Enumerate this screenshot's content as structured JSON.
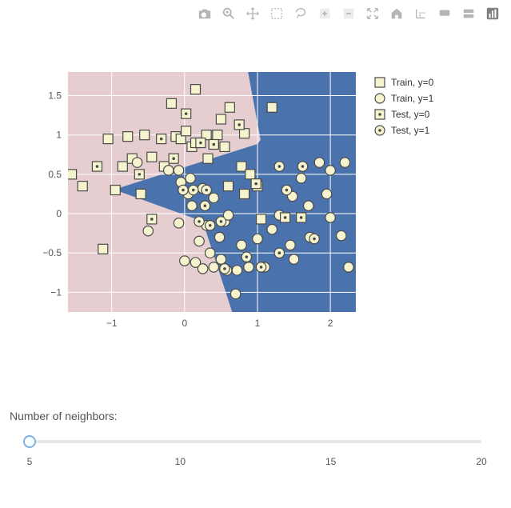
{
  "toolbar": {
    "icons": [
      "camera-icon",
      "zoom-icon",
      "pan-icon",
      "box-select-icon",
      "lasso-select-icon",
      "zoom-in-icon",
      "zoom-out-icon",
      "autoscale-icon",
      "reset-axes-icon",
      "spike-lines-icon",
      "closest-hover-icon",
      "compare-hover-icon",
      "plotly-logo-icon"
    ]
  },
  "legend": {
    "items": [
      {
        "label": "Train, y=0"
      },
      {
        "label": "Train, y=1"
      },
      {
        "label": "Test, y=0"
      },
      {
        "label": "Test, y=1"
      }
    ]
  },
  "axes": {
    "xticks": [
      "−1",
      "0",
      "1",
      "2"
    ],
    "yticks": [
      "−1",
      "−0.5",
      "0",
      "0.5",
      "1",
      "1.5"
    ]
  },
  "slider": {
    "label": "Number of neighbors:",
    "min": 5,
    "max": 20,
    "value": 5,
    "ticks": [
      "5",
      "10",
      "15",
      "20"
    ]
  },
  "chart_data": {
    "type": "scatter",
    "title": "",
    "xlabel": "",
    "ylabel": "",
    "xlim": [
      -1.6,
      2.35
    ],
    "ylim": [
      -1.25,
      1.8
    ],
    "background": "decision-boundary-contour (red=y0, blue=y1)",
    "series": [
      {
        "name": "Train, y=0",
        "marker": "square",
        "points": [
          [
            -1.55,
            0.5
          ],
          [
            -1.4,
            0.35
          ],
          [
            -1.12,
            -0.45
          ],
          [
            -1.05,
            0.95
          ],
          [
            -0.95,
            0.3
          ],
          [
            -0.85,
            0.6
          ],
          [
            -0.78,
            0.98
          ],
          [
            -0.72,
            0.7
          ],
          [
            -0.6,
            0.25
          ],
          [
            -0.55,
            1.0
          ],
          [
            -0.45,
            0.72
          ],
          [
            -0.28,
            0.6
          ],
          [
            -0.18,
            1.4
          ],
          [
            -0.12,
            0.98
          ],
          [
            -0.05,
            0.95
          ],
          [
            0.02,
            1.05
          ],
          [
            0.1,
            0.85
          ],
          [
            0.15,
            0.9
          ],
          [
            0.15,
            1.58
          ],
          [
            0.3,
            1.0
          ],
          [
            0.32,
            0.7
          ],
          [
            0.4,
            0.88
          ],
          [
            0.45,
            1.0
          ],
          [
            0.5,
            1.2
          ],
          [
            0.55,
            0.85
          ],
          [
            0.6,
            0.35
          ],
          [
            0.62,
            1.35
          ],
          [
            0.78,
            0.6
          ],
          [
            0.82,
            0.25
          ],
          [
            0.82,
            1.02
          ],
          [
            0.9,
            0.5
          ],
          [
            1.0,
            0.35
          ],
          [
            1.05,
            -0.07
          ],
          [
            1.2,
            1.35
          ]
        ]
      },
      {
        "name": "Train, y=1",
        "marker": "circle",
        "points": [
          [
            -0.65,
            0.65
          ],
          [
            -0.5,
            -0.22
          ],
          [
            -0.22,
            0.55
          ],
          [
            -0.08,
            0.55
          ],
          [
            -0.08,
            -0.12
          ],
          [
            -0.05,
            0.4
          ],
          [
            0.0,
            -0.6
          ],
          [
            0.05,
            0.25
          ],
          [
            0.08,
            0.45
          ],
          [
            0.1,
            0.1
          ],
          [
            0.15,
            -0.62
          ],
          [
            0.2,
            -0.35
          ],
          [
            0.25,
            0.32
          ],
          [
            0.25,
            -0.7
          ],
          [
            0.3,
            -0.15
          ],
          [
            0.35,
            -0.5
          ],
          [
            0.4,
            0.2
          ],
          [
            0.4,
            -0.68
          ],
          [
            0.48,
            -0.3
          ],
          [
            0.5,
            -0.58
          ],
          [
            0.55,
            -0.1
          ],
          [
            0.58,
            -0.72
          ],
          [
            0.6,
            -0.02
          ],
          [
            0.7,
            -1.02
          ],
          [
            0.72,
            -0.72
          ],
          [
            0.78,
            -0.4
          ],
          [
            0.88,
            -0.68
          ],
          [
            1.0,
            -0.32
          ],
          [
            1.1,
            -0.68
          ],
          [
            1.2,
            -0.2
          ],
          [
            1.3,
            -0.02
          ],
          [
            1.45,
            -0.4
          ],
          [
            1.48,
            0.22
          ],
          [
            1.5,
            -0.58
          ],
          [
            1.6,
            0.45
          ],
          [
            1.7,
            0.1
          ],
          [
            1.72,
            -0.3
          ],
          [
            1.85,
            0.65
          ],
          [
            1.95,
            0.25
          ],
          [
            2.0,
            -0.05
          ],
          [
            2.0,
            0.55
          ],
          [
            2.15,
            -0.28
          ],
          [
            2.2,
            0.65
          ],
          [
            2.25,
            -0.68
          ]
        ]
      },
      {
        "name": "Test, y=0",
        "marker": "square-dot",
        "points": [
          [
            -1.2,
            0.6
          ],
          [
            -0.62,
            0.5
          ],
          [
            -0.45,
            -0.07
          ],
          [
            -0.32,
            0.95
          ],
          [
            -0.15,
            0.7
          ],
          [
            0.02,
            1.27
          ],
          [
            0.22,
            0.9
          ],
          [
            0.4,
            0.88
          ],
          [
            0.75,
            1.13
          ],
          [
            0.98,
            0.38
          ],
          [
            1.38,
            -0.05
          ],
          [
            1.6,
            -0.05
          ]
        ]
      },
      {
        "name": "Test, y=1",
        "marker": "circle-dot",
        "points": [
          [
            -0.02,
            0.3
          ],
          [
            0.12,
            0.3
          ],
          [
            0.2,
            -0.1
          ],
          [
            0.28,
            0.1
          ],
          [
            0.3,
            0.3
          ],
          [
            0.35,
            -0.15
          ],
          [
            0.5,
            -0.1
          ],
          [
            0.55,
            -0.7
          ],
          [
            0.85,
            -0.55
          ],
          [
            1.05,
            -0.68
          ],
          [
            1.3,
            -0.5
          ],
          [
            1.3,
            0.6
          ],
          [
            1.4,
            0.3
          ],
          [
            1.62,
            0.6
          ],
          [
            1.78,
            -0.32
          ]
        ]
      }
    ]
  }
}
